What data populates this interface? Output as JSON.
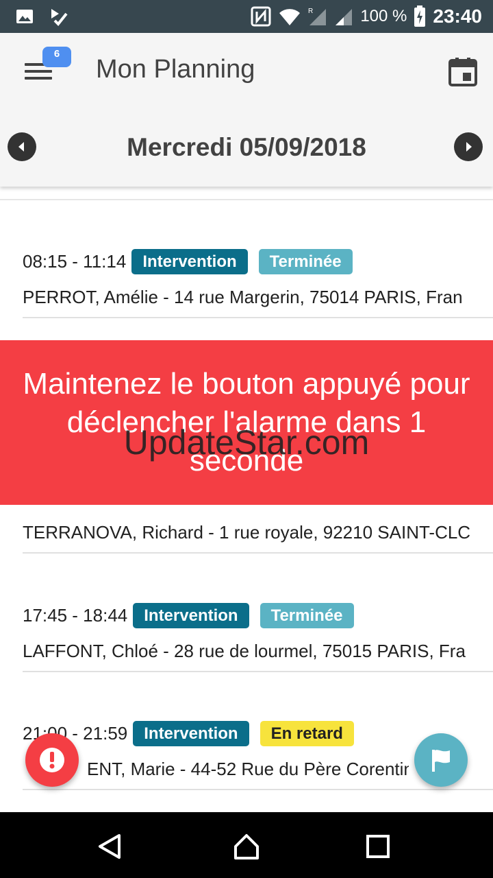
{
  "status_bar": {
    "battery": "100 %",
    "time": "23:40",
    "icons": [
      "image-icon",
      "check-app-icon",
      "nfc-icon",
      "wifi-icon",
      "signal-roaming-icon",
      "signal-icon",
      "battery-charging-icon"
    ]
  },
  "header": {
    "title": "Mon Planning",
    "menu_badge": "6",
    "date": "Mercredi 05/09/2018"
  },
  "items": [
    {
      "time": "08:15 - 11:14",
      "type": "Intervention",
      "status": "Terminée",
      "status_kind": "done",
      "address": "PERROT, Amélie - 14 rue Margerin, 75014 PARIS, Fran"
    },
    {
      "time": "",
      "type": "",
      "status": "",
      "status_kind": "",
      "address": "TERRANOVA, Richard - 1 rue royale, 92210 SAINT-CLC"
    },
    {
      "time": "17:45 - 18:44",
      "type": "Intervention",
      "status": "Terminée",
      "status_kind": "done",
      "address": "LAFFONT, Chloé - 28 rue de lourmel, 75015 PARIS, Fra"
    },
    {
      "time": "21:00 - 21:59",
      "type": "Intervention",
      "status": "En retard",
      "status_kind": "late",
      "address": "ENT, Marie - 44-52 Rue du Père Corentin"
    }
  ],
  "alarm_toast": {
    "message": "Maintenez le bouton appuyé pour déclencher l'alarme dans 1 seconde"
  },
  "watermark": "UpdateStar.com",
  "colors": {
    "status_bar": "#37474f",
    "intervention_badge": "#0b6e8a",
    "done_badge": "#5bb3c4",
    "late_badge": "#f7e33c",
    "alarm": "#f43e44"
  }
}
